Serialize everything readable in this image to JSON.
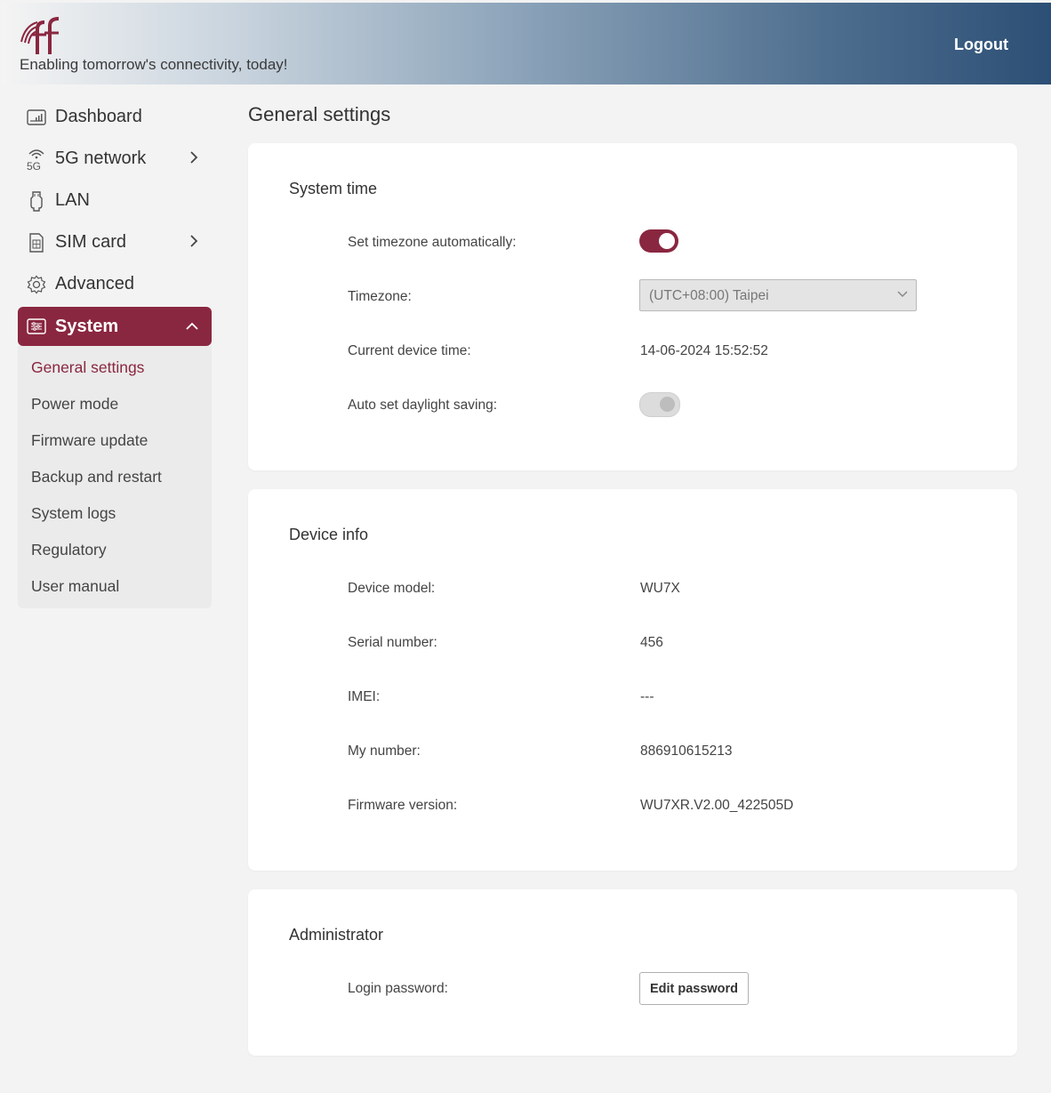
{
  "header": {
    "tagline": "Enabling tomorrow's connectivity, today!",
    "logout_label": "Logout",
    "logo_icon": "rf-logo-icon"
  },
  "sidebar": {
    "items": [
      {
        "label": "Dashboard",
        "icon": "dashboard-icon",
        "has_submenu": false
      },
      {
        "label": "5G network",
        "icon": "5g-icon",
        "has_submenu": true
      },
      {
        "label": "LAN",
        "icon": "ethernet-icon",
        "has_submenu": false
      },
      {
        "label": "SIM card",
        "icon": "sim-card-icon",
        "has_submenu": true
      },
      {
        "label": "Advanced",
        "icon": "gear-icon",
        "has_submenu": false
      },
      {
        "label": "System",
        "icon": "system-icon",
        "has_submenu": true,
        "active": true
      }
    ],
    "system_submenu": [
      "General settings",
      "Power mode",
      "Firmware update",
      "Backup and restart",
      "System logs",
      "Regulatory",
      "User manual"
    ],
    "current_submenu_item": "General settings"
  },
  "page": {
    "title": "General settings"
  },
  "system_time": {
    "title": "System time",
    "set_timezone_label": "Set timezone automatically:",
    "set_timezone_on": true,
    "timezone_label": "Timezone:",
    "timezone_value": "(UTC+08:00) Taipei",
    "device_time_label": "Current device time:",
    "device_time_value": "14-06-2024 15:52:52",
    "daylight_label": "Auto set daylight saving:",
    "daylight_on": false
  },
  "device_info": {
    "title": "Device info",
    "model_label": "Device model:",
    "model_value": "WU7X",
    "serial_label": "Serial number:",
    "serial_value": "456",
    "imei_label": "IMEI:",
    "imei_value": "---",
    "number_label": "My number:",
    "number_value": "886910615213",
    "firmware_label": "Firmware version:",
    "firmware_value": "WU7XR.V2.00_422505D"
  },
  "administrator": {
    "title": "Administrator",
    "password_label": "Login password:",
    "edit_password_label": "Edit password"
  },
  "colors": {
    "accent": "#8a2740",
    "header_gradient_end": "#2c4f75",
    "toggle_off": "#dcdcdc"
  }
}
